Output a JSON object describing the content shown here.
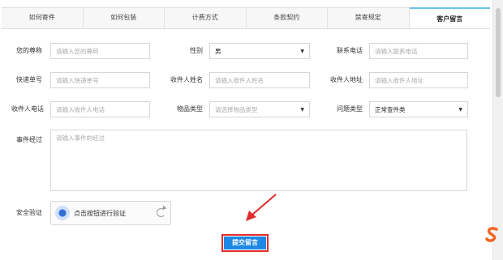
{
  "tabs": [
    {
      "label": "如何寄件",
      "active": false
    },
    {
      "label": "如何包装",
      "active": false
    },
    {
      "label": "计费方式",
      "active": false
    },
    {
      "label": "条款契约",
      "active": false
    },
    {
      "label": "禁寄规定",
      "active": false
    },
    {
      "label": "客户留言",
      "active": true
    }
  ],
  "form": {
    "name": {
      "label": "您的尊称",
      "placeholder": "请输入您的尊称"
    },
    "gender": {
      "label": "性别",
      "value": "男"
    },
    "phone": {
      "label": "联系电话",
      "placeholder": "请输入联系电话"
    },
    "tracking": {
      "label": "快递单号",
      "placeholder": "请输入快递单号"
    },
    "recipient_name": {
      "label": "收件人姓名",
      "placeholder": "请输入收件人姓名"
    },
    "recipient_address": {
      "label": "收件人地址",
      "placeholder": "请输入收件人地址"
    },
    "recipient_phone": {
      "label": "收件人电话",
      "placeholder": "请输入收件人电话"
    },
    "item_type": {
      "label": "物品类型",
      "placeholder": "请选择物品类型"
    },
    "issue_type": {
      "label": "问题类型",
      "value": "正常查件类"
    },
    "details": {
      "label": "事件经过",
      "placeholder": "请输入事件的经过"
    },
    "verify": {
      "label": "安全验证",
      "button": "点击按钮进行验证"
    },
    "submit": "提交留言"
  },
  "colors": {
    "accent": "#1e88e5",
    "highlight": "#e02b2b",
    "tab_active": "#6cc0ec"
  }
}
